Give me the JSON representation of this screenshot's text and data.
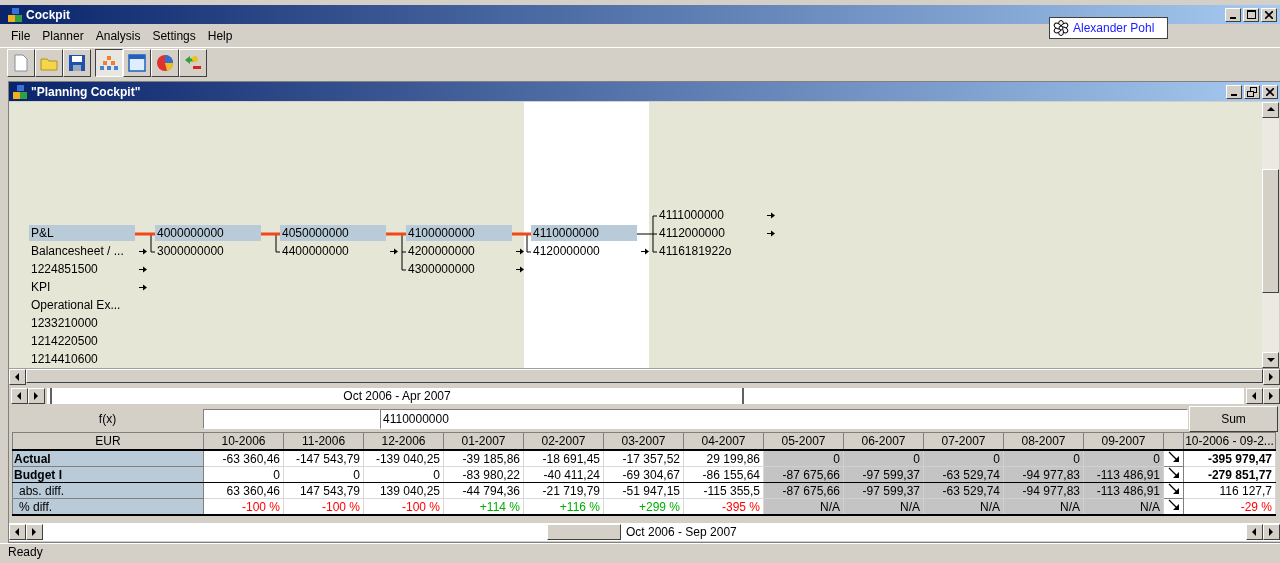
{
  "window": {
    "title": "Cockpit"
  },
  "user": {
    "name": "Alexander Pohl"
  },
  "menu": [
    "File",
    "Planner",
    "Analysis",
    "Settings",
    "Help"
  ],
  "toolbar": [
    [
      {
        "kind": "new",
        "selected": false
      },
      {
        "kind": "open",
        "selected": false
      },
      {
        "kind": "save",
        "selected": false
      }
    ],
    [
      {
        "kind": "hierarchy",
        "selected": true
      },
      {
        "kind": "table",
        "selected": false
      },
      {
        "kind": "chart",
        "selected": false
      },
      {
        "kind": "swap",
        "selected": false
      }
    ]
  ],
  "document": {
    "title": "\"Planning Cockpit\"",
    "tree": [
      {
        "label": "P&L",
        "selected": true,
        "children": [
          {
            "label": "4000000000",
            "selected": true,
            "children": [
              {
                "label": "4050000000",
                "selected": true,
                "children": [
                  {
                    "label": "4100000000",
                    "selected": true,
                    "children": [
                      {
                        "label": "4110000000",
                        "selected": true,
                        "children": [
                          {
                            "label": "4111000000",
                            "selected": false,
                            "has_more": true
                          },
                          {
                            "label": "4112000000",
                            "selected": false,
                            "has_more": true
                          },
                          {
                            "label": "4116181922o",
                            "selected": false
                          }
                        ]
                      },
                      {
                        "label": "4120000000",
                        "selected": false,
                        "has_more": true
                      }
                    ]
                  },
                  {
                    "label": "4200000000",
                    "selected": false,
                    "has_more": true
                  },
                  {
                    "label": "4300000000",
                    "selected": false,
                    "has_more": true
                  }
                ]
              },
              {
                "label": "4400000000",
                "selected": false,
                "has_more": true
              }
            ]
          },
          {
            "label": "3000000000",
            "selected": false
          }
        ]
      },
      {
        "label": "Balancesheet / ...",
        "selected": false,
        "has_more": true
      },
      {
        "label": "1224851500",
        "selected": false,
        "has_more": true
      },
      {
        "label": "KPI",
        "selected": false,
        "has_more": true
      },
      {
        "label": "Operational Ex...",
        "selected": false
      },
      {
        "label": "1233210000",
        "selected": false
      },
      {
        "label": "1214220500",
        "selected": false
      },
      {
        "label": "1214410600",
        "selected": false
      }
    ],
    "period_slider": {
      "label": "Oct 2006 - Apr 2007"
    },
    "formula": {
      "label": "f(x)",
      "value": "4110000000",
      "button": "Sum"
    },
    "table": {
      "corner": "EUR",
      "total_header": "10-2006 - 09-2...",
      "columns": [
        {
          "label": "10-2006",
          "shaded": false
        },
        {
          "label": "11-2006",
          "shaded": false
        },
        {
          "label": "12-2006",
          "shaded": false
        },
        {
          "label": "01-2007",
          "shaded": false
        },
        {
          "label": "02-2007",
          "shaded": false
        },
        {
          "label": "03-2007",
          "shaded": false
        },
        {
          "label": "04-2007",
          "shaded": false
        },
        {
          "label": "05-2007",
          "shaded": true
        },
        {
          "label": "06-2007",
          "shaded": true
        },
        {
          "label": "07-2007",
          "shaded": true
        },
        {
          "label": "08-2007",
          "shaded": true
        },
        {
          "label": "09-2007",
          "shaded": true
        }
      ],
      "rows": [
        {
          "label": "Actual",
          "bold": true,
          "indented": false,
          "total": "-395 979,47",
          "cells": [
            "-63 360,46",
            "-147 543,79",
            "-139 040,25",
            "-39 185,86",
            "-18 691,45",
            "-17 357,52",
            "29 199,86",
            "0",
            "0",
            "0",
            "0",
            "0"
          ]
        },
        {
          "label": "Budget I",
          "bold": true,
          "indented": false,
          "total": "-279 851,77",
          "cells": [
            "0",
            "0",
            "0",
            "-83 980,22",
            "-40 411,24",
            "-69 304,67",
            "-86 155,64",
            "-87 675,66",
            "-97 599,37",
            "-63 529,74",
            "-94 977,83",
            "-113 486,91"
          ]
        },
        {
          "label": "abs. diff.",
          "bold": false,
          "indented": true,
          "total": "116 127,7",
          "cells": [
            "63 360,46",
            "147 543,79",
            "139 040,25",
            "-44 794,36",
            "-21 719,79",
            "-51 947,15",
            "-115 355,5",
            "-87 675,66",
            "-97 599,37",
            "-63 529,74",
            "-94 977,83",
            "-113 486,91"
          ]
        },
        {
          "label": "% diff.",
          "bold": false,
          "indented": true,
          "total": "-29 %",
          "total_favorable": false,
          "cells": [
            {
              "value": "-100 %",
              "favorable": false
            },
            {
              "value": "-100 %",
              "favorable": false
            },
            {
              "value": "-100 %",
              "favorable": false
            },
            {
              "value": "+114 %",
              "favorable": true
            },
            {
              "value": "+116 %",
              "favorable": true
            },
            {
              "value": "+299 %",
              "favorable": true
            },
            {
              "value": "-395 %",
              "favorable": false
            },
            {
              "value": "N/A"
            },
            {
              "value": "N/A"
            },
            {
              "value": "N/A"
            },
            {
              "value": "N/A"
            },
            {
              "value": "N/A"
            }
          ]
        }
      ]
    },
    "range_slider": {
      "label": "Oct 2006 - Sep 2007"
    }
  },
  "status_bar": "Ready"
}
